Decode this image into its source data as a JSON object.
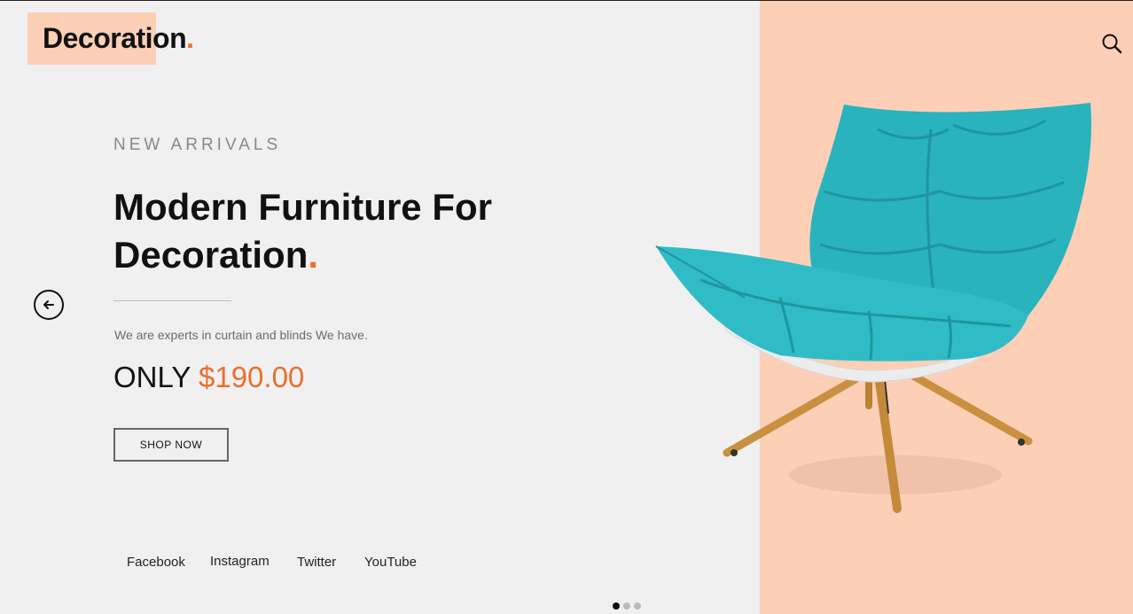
{
  "brand": {
    "name": "Decoration",
    "dot": ".",
    "accent_color": "#ec6f2d",
    "panel_color": "#fecfb7"
  },
  "header": {
    "search_icon": "search-icon"
  },
  "hero": {
    "eyebrow": "NEW ARRIVALS",
    "title_line1": "Modern Furniture For",
    "title_line2": "Decoration",
    "title_dot": ".",
    "tagline": "We are experts in curtain and blinds We have.",
    "price_prefix": "ONLY",
    "price": "$190.00",
    "cta_label": "SHOP NOW",
    "prev_icon": "arrow-left-icon",
    "image": "teal-lounge-chair"
  },
  "social": [
    {
      "label": "Facebook"
    },
    {
      "label": "Instagram"
    },
    {
      "label": "Twitter"
    },
    {
      "label": "YouTube"
    }
  ],
  "slider": {
    "count": 3,
    "active_index": 0
  }
}
